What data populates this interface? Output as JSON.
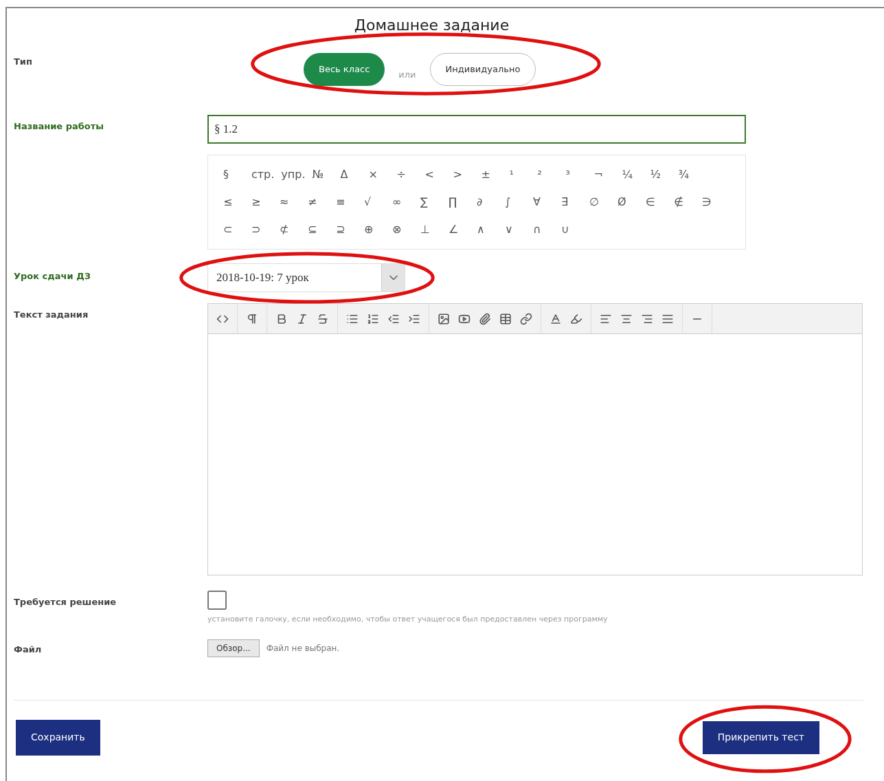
{
  "title": "Домашнее задание",
  "type_field": {
    "label": "Тип",
    "options": [
      {
        "label": "Весь класс",
        "selected": true
      },
      {
        "label": "Индивидуально",
        "selected": false
      }
    ],
    "separator": "или"
  },
  "work_name": {
    "label": "Название работы",
    "value": "§ 1.2"
  },
  "symbols": [
    [
      "§",
      "стр.",
      "упр.",
      "№",
      "Δ",
      "×",
      "÷",
      "<",
      ">",
      "±",
      "¹",
      "²",
      "³",
      "¬",
      "¼",
      "½",
      "¾"
    ],
    [
      "≤",
      "≥",
      "≈",
      "≠",
      "≡",
      "√",
      "∞",
      "∑",
      "∏",
      "∂",
      "∫",
      "∀",
      "∃",
      "∅",
      "Ø",
      "∈",
      "∉",
      "∋"
    ],
    [
      "⊂",
      "⊃",
      "⊄",
      "⊆",
      "⊇",
      "⊕",
      "⊗",
      "⊥",
      "∠",
      "∧",
      "∨",
      "∩",
      "∪"
    ]
  ],
  "lesson": {
    "label": "Урок сдачи ДЗ",
    "value": "2018-10-19: 7 урок"
  },
  "task_text": {
    "label": "Текст задания"
  },
  "solution": {
    "label": "Требуется решение",
    "checked": false,
    "hint": "установите галочку, если необходимо, чтобы ответ учащегося был предоставлен через программу"
  },
  "file": {
    "label": "Файл",
    "button": "Обзор...",
    "status": "Файл не выбран."
  },
  "buttons": {
    "save": "Сохранить",
    "attach": "Прикрепить тест"
  }
}
